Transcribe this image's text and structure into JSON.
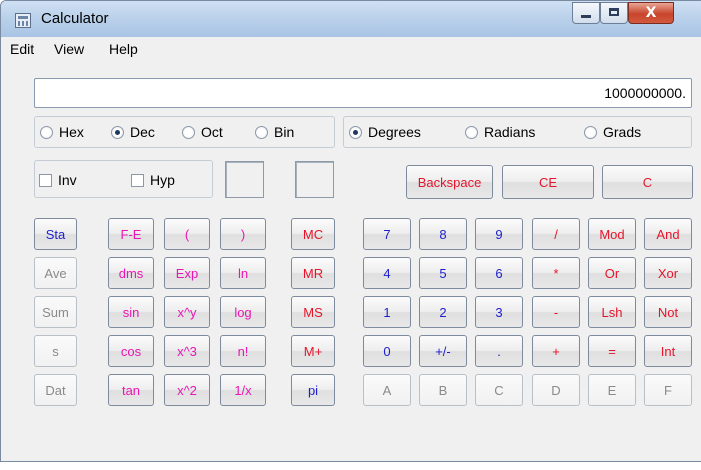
{
  "window": {
    "title": "Calculator",
    "close_glyph": "X"
  },
  "menu": {
    "items": [
      "Edit",
      "View",
      "Help"
    ]
  },
  "display": {
    "value": "1000000000."
  },
  "base_group": {
    "options": [
      {
        "label": "Hex",
        "selected": false
      },
      {
        "label": "Dec",
        "selected": true
      },
      {
        "label": "Oct",
        "selected": false
      },
      {
        "label": "Bin",
        "selected": false
      }
    ]
  },
  "angle_group": {
    "options": [
      {
        "label": "Degrees",
        "selected": true
      },
      {
        "label": "Radians",
        "selected": false
      },
      {
        "label": "Grads",
        "selected": false
      }
    ]
  },
  "modifiers": {
    "inv": "Inv",
    "hyp": "Hyp"
  },
  "edit_buttons": {
    "backspace": "Backspace",
    "ce": "CE",
    "c": "C"
  },
  "stat_buttons": [
    "Sta",
    "Ave",
    "Sum",
    "s",
    "Dat"
  ],
  "sci_buttons": [
    [
      "F-E",
      "(",
      ")"
    ],
    [
      "dms",
      "Exp",
      "ln"
    ],
    [
      "sin",
      "x^y",
      "log"
    ],
    [
      "cos",
      "x^3",
      "n!"
    ],
    [
      "tan",
      "x^2",
      "1/x"
    ]
  ],
  "memory_buttons": [
    "MC",
    "MR",
    "MS",
    "M+",
    "pi"
  ],
  "keypad": [
    [
      "7",
      "8",
      "9",
      "/",
      "Mod",
      "And"
    ],
    [
      "4",
      "5",
      "6",
      "*",
      "Or",
      "Xor"
    ],
    [
      "1",
      "2",
      "3",
      "-",
      "Lsh",
      "Not"
    ],
    [
      "0",
      "+/-",
      ".",
      "+",
      "=",
      "Int"
    ],
    [
      "A",
      "B",
      "C",
      "D",
      "E",
      "F"
    ]
  ],
  "colors": {
    "red": "#e6142b",
    "blue": "#1e1ecf",
    "pink": "#ea16b4",
    "gray": "#8a8a8a"
  }
}
